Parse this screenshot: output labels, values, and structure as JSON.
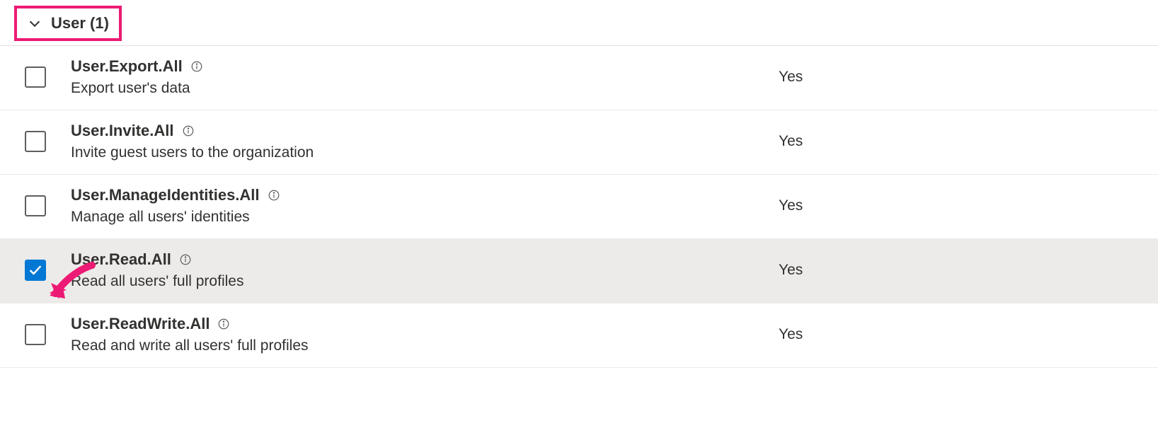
{
  "section": {
    "label": "User (1)",
    "expanded": true
  },
  "permissions": [
    {
      "name": "User.Export.All",
      "description": "Export user's data",
      "admin_consent": "Yes",
      "checked": false
    },
    {
      "name": "User.Invite.All",
      "description": "Invite guest users to the organization",
      "admin_consent": "Yes",
      "checked": false
    },
    {
      "name": "User.ManageIdentities.All",
      "description": "Manage all users' identities",
      "admin_consent": "Yes",
      "checked": false
    },
    {
      "name": "User.Read.All",
      "description": "Read all users' full profiles",
      "admin_consent": "Yes",
      "checked": true
    },
    {
      "name": "User.ReadWrite.All",
      "description": "Read and write all users' full profiles",
      "admin_consent": "Yes",
      "checked": false
    }
  ],
  "annotations": {
    "highlight_color": "#ed1a75"
  }
}
